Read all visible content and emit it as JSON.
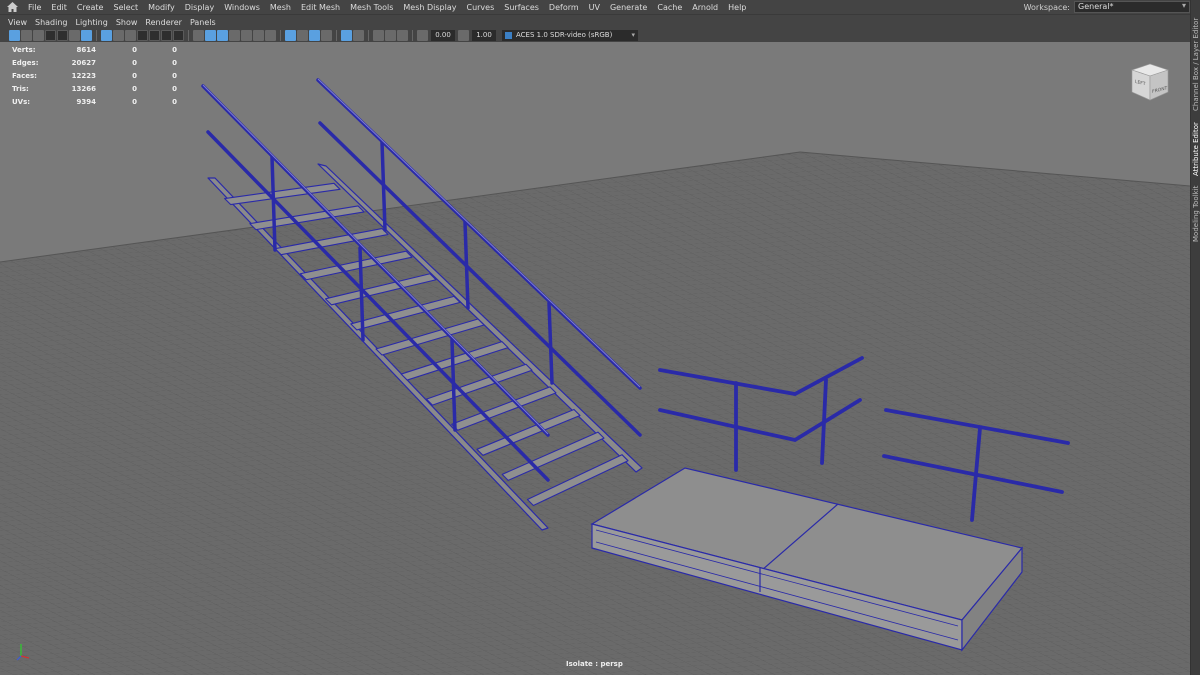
{
  "menubar": {
    "items": [
      "File",
      "Edit",
      "Create",
      "Select",
      "Modify",
      "Display",
      "Windows",
      "Mesh",
      "Edit Mesh",
      "Mesh Tools",
      "Mesh Display",
      "Curves",
      "Surfaces",
      "Deform",
      "UV",
      "Generate",
      "Cache",
      "Arnold",
      "Help"
    ],
    "workspace_label": "Workspace:",
    "workspace_value": "General*"
  },
  "panel_menu": {
    "items": [
      "View",
      "Shading",
      "Lighting",
      "Show",
      "Renderer",
      "Panels"
    ]
  },
  "toolbar": {
    "value_1": "0.00",
    "value_2": "1.00",
    "color_space": "ACES 1.0 SDR-video (sRGB)"
  },
  "hud": {
    "rows": [
      {
        "label": "Verts:",
        "v1": "8614",
        "v2": "0",
        "v3": "0"
      },
      {
        "label": "Edges:",
        "v1": "20627",
        "v2": "0",
        "v3": "0"
      },
      {
        "label": "Faces:",
        "v1": "12223",
        "v2": "0",
        "v3": "0"
      },
      {
        "label": "Tris:",
        "v1": "13266",
        "v2": "0",
        "v3": "0"
      },
      {
        "label": "UVs:",
        "v1": "9394",
        "v2": "0",
        "v3": "0"
      }
    ]
  },
  "viewport": {
    "status_text": "Isolate : persp",
    "viewcube_left": "LEFT",
    "viewcube_front": "FRONT",
    "wire_color": "#2a2aa8",
    "grid_color": "#5a5a5a",
    "floor_color": "#6b6b6b",
    "bg_color": "#7c7c7c"
  },
  "right_tabs": {
    "channel_box": "Channel Box / Layer Editor",
    "attribute_editor": "Attribute Editor",
    "modeling_toolkit": "Modeling Toolkit"
  }
}
